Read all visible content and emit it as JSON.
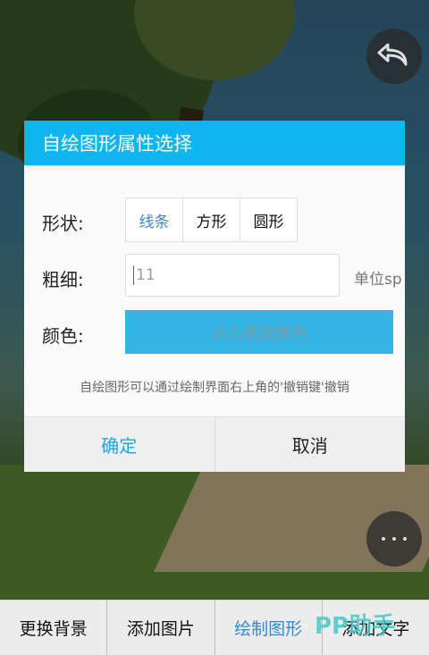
{
  "dialog": {
    "title": "自绘图形属性选择",
    "shape_label": "形状:",
    "shapes": [
      "线条",
      "方形",
      "圆形"
    ],
    "selected_shape": "线条",
    "size_label": "粗细:",
    "size_value": "11",
    "unit": "单位sp",
    "color_label": "颜色:",
    "color_button": "点击更改颜色",
    "hint": "自绘图形可以通过绘制界面右上角的'撤销键'撤销",
    "confirm": "确定",
    "cancel": "取消"
  },
  "bottom_bar": {
    "items": [
      "更换背景",
      "添加图片",
      "绘制图形",
      "添加文字"
    ],
    "active_item": "绘制图形"
  },
  "watermark": "PP助手",
  "colors": {
    "header": "#0fb5f0",
    "color_button": "#33b5e5",
    "accent_text": "#2e8bd6"
  }
}
